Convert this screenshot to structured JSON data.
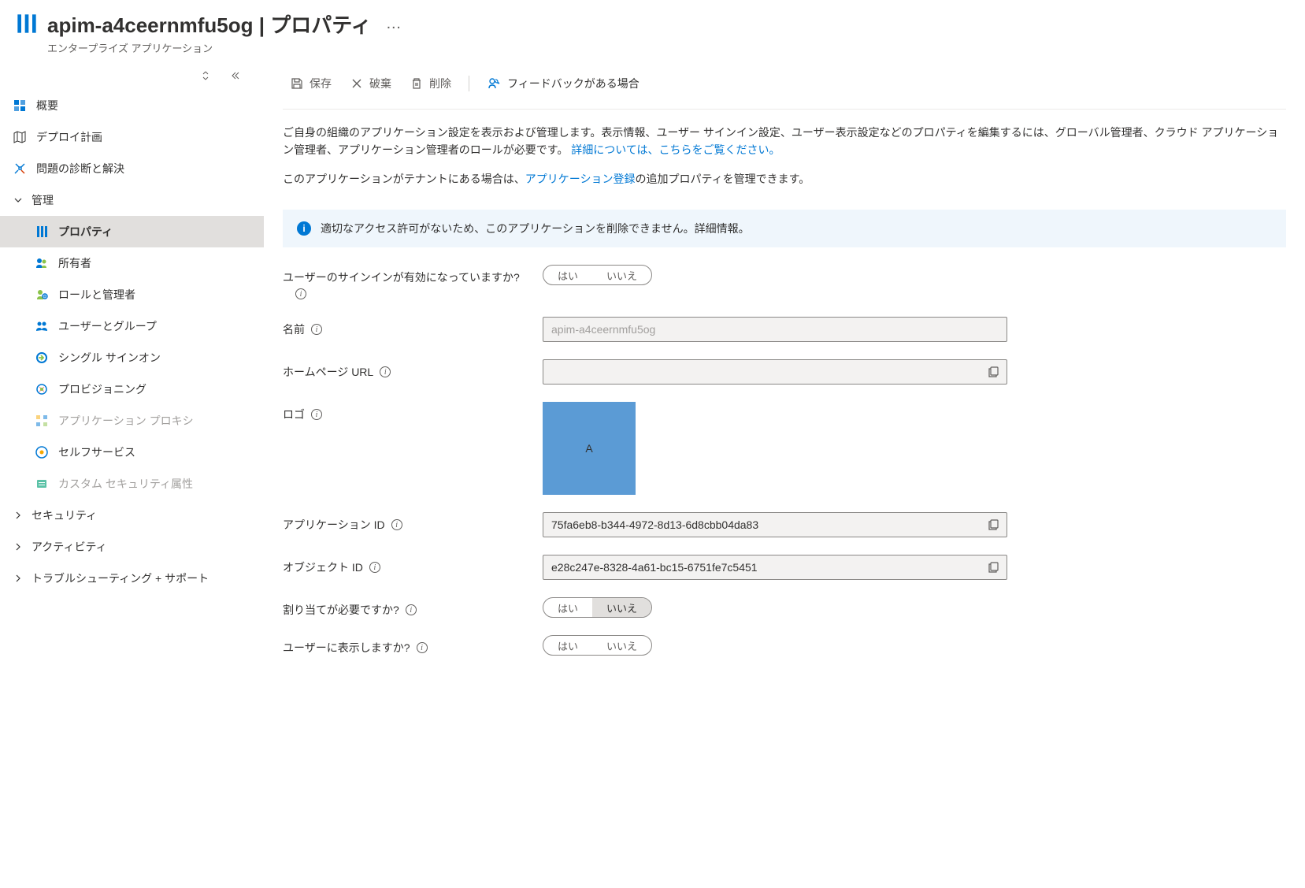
{
  "header": {
    "title": "apim-a4ceernmfu5og | プロパティ",
    "subtitle": "エンタープライズ アプリケーション"
  },
  "sidebar": {
    "overview": "概要",
    "deploy_plan": "デプロイ計画",
    "diagnose": "問題の診断と解決",
    "group_manage": "管理",
    "properties": "プロパティ",
    "owners": "所有者",
    "roles_admins": "ロールと管理者",
    "users_groups": "ユーザーとグループ",
    "sso": "シングル サインオン",
    "provisioning": "プロビジョニング",
    "app_proxy": "アプリケーション プロキシ",
    "self_service": "セルフサービス",
    "custom_sec": "カスタム セキュリティ属性",
    "group_security": "セキュリティ",
    "group_activity": "アクティビティ",
    "group_trouble": "トラブルシューティング + サポート"
  },
  "toolbar": {
    "save": "保存",
    "discard": "破棄",
    "delete": "削除",
    "feedback": "フィードバックがある場合"
  },
  "main": {
    "desc_part1": "ご自身の組織のアプリケーション設定を表示および管理します。表示情報、ユーザー サインイン設定、ユーザー表示設定などのプロパティを編集するには、グローバル管理者、クラウド アプリケーション管理者、アプリケーション管理者のロールが必要です。",
    "desc_link1": "詳細については、こちらをご覧ください。",
    "desc_part2a": "このアプリケーションがテナントにある場合は、",
    "desc_link2": "アプリケーション登録",
    "desc_part2b": "の追加プロパティを管理できます。",
    "banner": "適切なアクセス許可がないため、このアプリケーションを削除できません。詳細情報。",
    "labels": {
      "signin_enabled": "ユーザーのサインインが有効になっていますか?",
      "name": "名前",
      "homepage": "ホームページ URL",
      "logo": "ロゴ",
      "app_id": "アプリケーション ID",
      "object_id": "オブジェクト ID",
      "assignment_required": "割り当てが必要ですか?",
      "visible_to_users": "ユーザーに表示しますか?"
    },
    "values": {
      "name": "apim-a4ceernmfu5og",
      "homepage": "",
      "logo_letter": "A",
      "app_id": "75fa6eb8-b344-4972-8d13-6d8cbb04da83",
      "object_id": "e28c247e-8328-4a61-bc15-6751fe7c5451"
    },
    "toggle": {
      "yes": "はい",
      "no": "いいえ"
    }
  }
}
